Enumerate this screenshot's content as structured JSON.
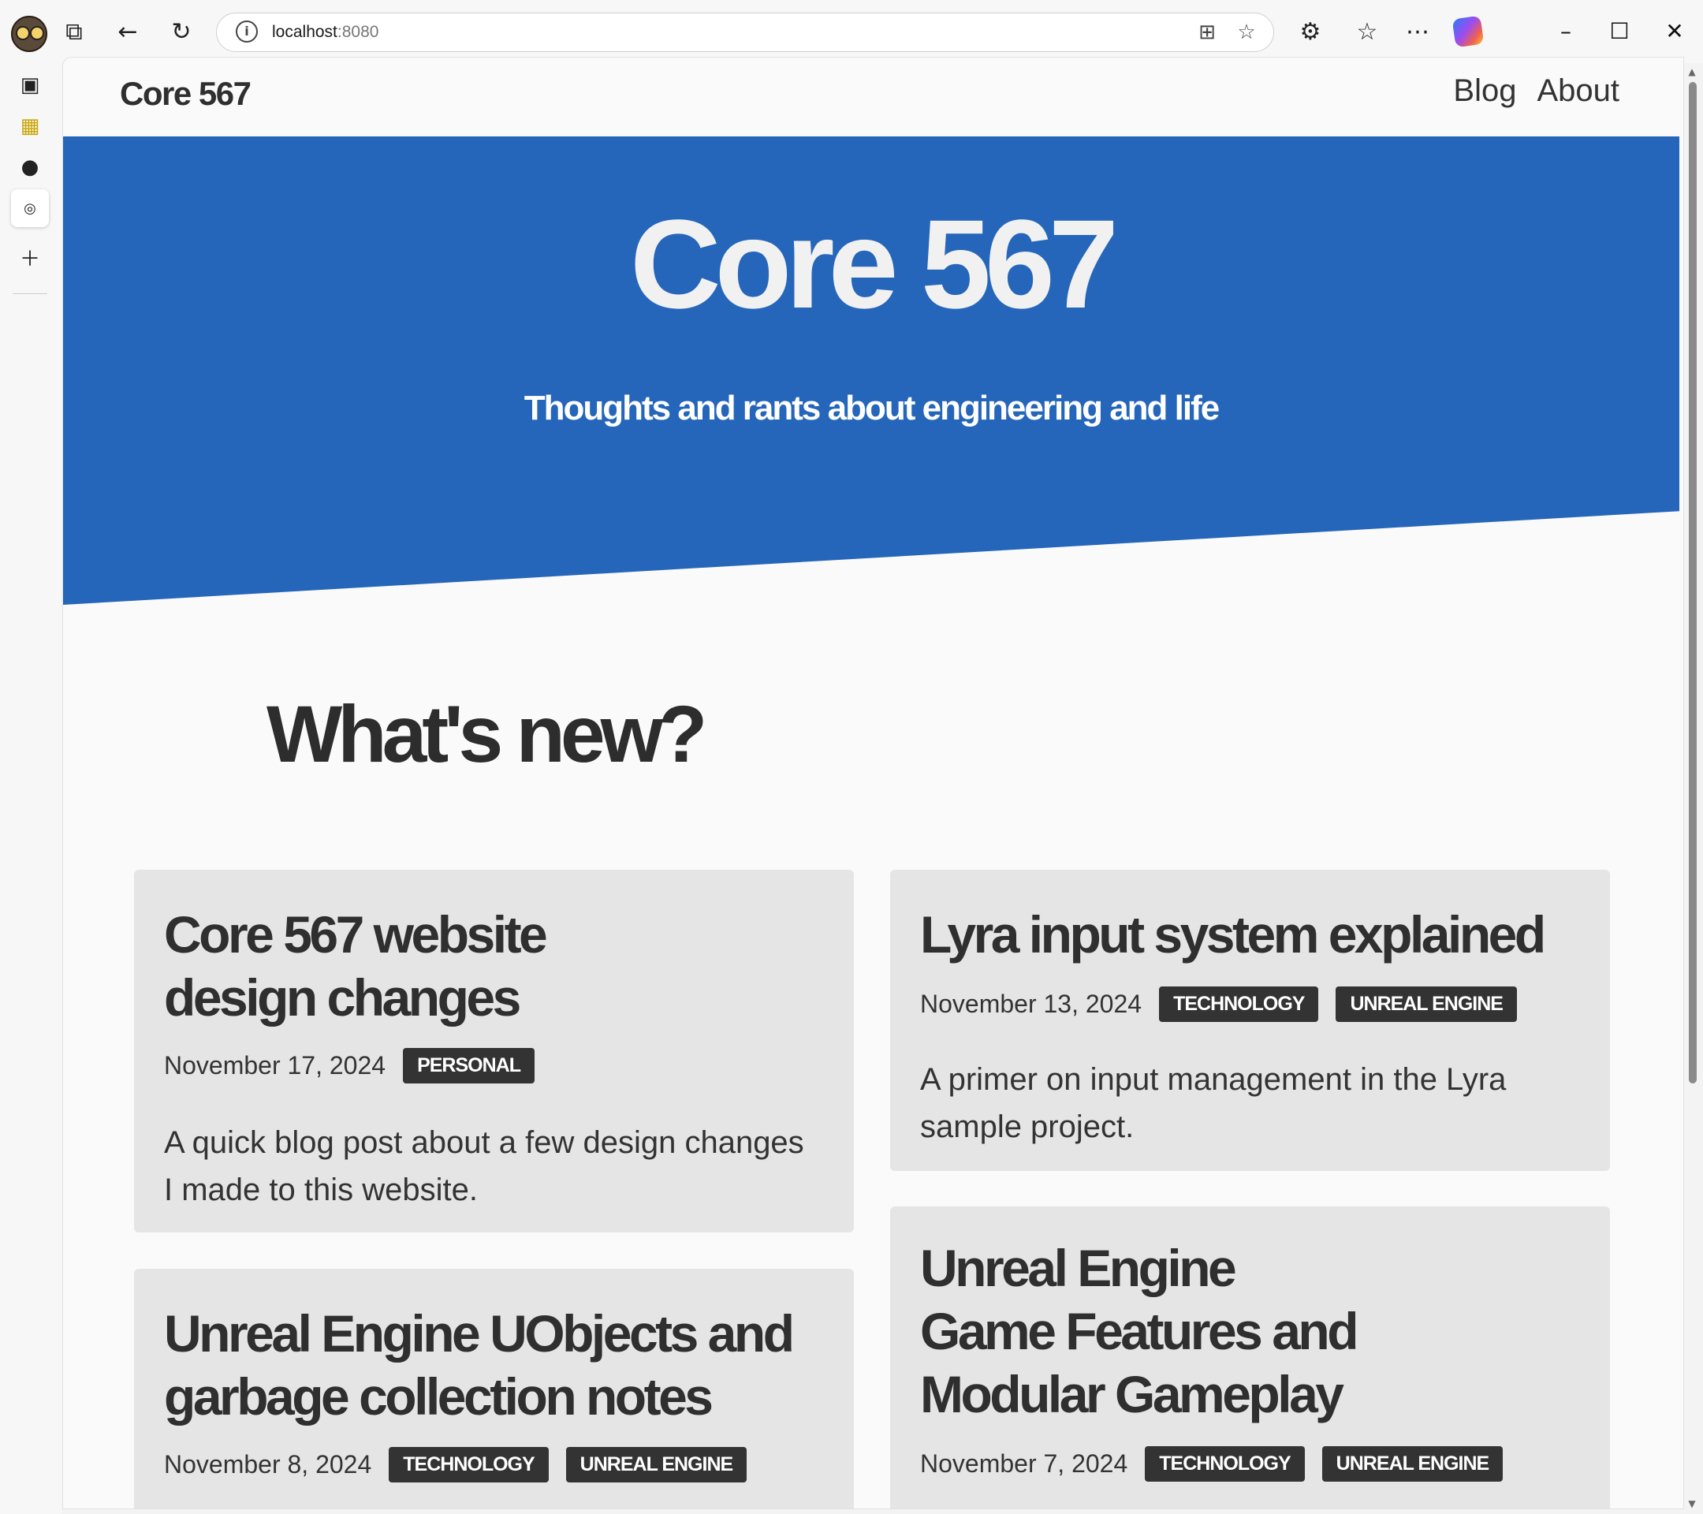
{
  "browser": {
    "url_host": "localhost",
    "url_port": ":8080"
  },
  "site": {
    "brand": "Core 567",
    "nav": [
      {
        "label": "Blog"
      },
      {
        "label": "About"
      }
    ]
  },
  "hero": {
    "title": "Core 567",
    "subtitle": "Thoughts and rants about engineering and life",
    "background_color": "#2566bb"
  },
  "section_title": "What's new?",
  "posts": [
    {
      "title_lines": [
        "Core 567 website",
        "design changes"
      ],
      "date": "November 17, 2024",
      "tags": [
        "PERSONAL"
      ],
      "excerpt": "A quick blog post about a few design changes I made to this website."
    },
    {
      "title_lines": [
        "Lyra input system explained"
      ],
      "date": "November 13, 2024",
      "tags": [
        "TECHNOLOGY",
        "UNREAL ENGINE"
      ],
      "excerpt": "A primer on input management in the Lyra sample project."
    },
    {
      "title_lines": [
        "Unreal Engine UObjects and",
        "garbage collection notes"
      ],
      "date": "November 8, 2024",
      "tags": [
        "TECHNOLOGY",
        "UNREAL ENGINE"
      ],
      "excerpt": ""
    },
    {
      "title_lines": [
        "Unreal Engine",
        "Game Features and",
        "Modular Gameplay"
      ],
      "date": "November 7, 2024",
      "tags": [
        "TECHNOLOGY",
        "UNREAL ENGINE"
      ],
      "excerpt": ""
    }
  ]
}
